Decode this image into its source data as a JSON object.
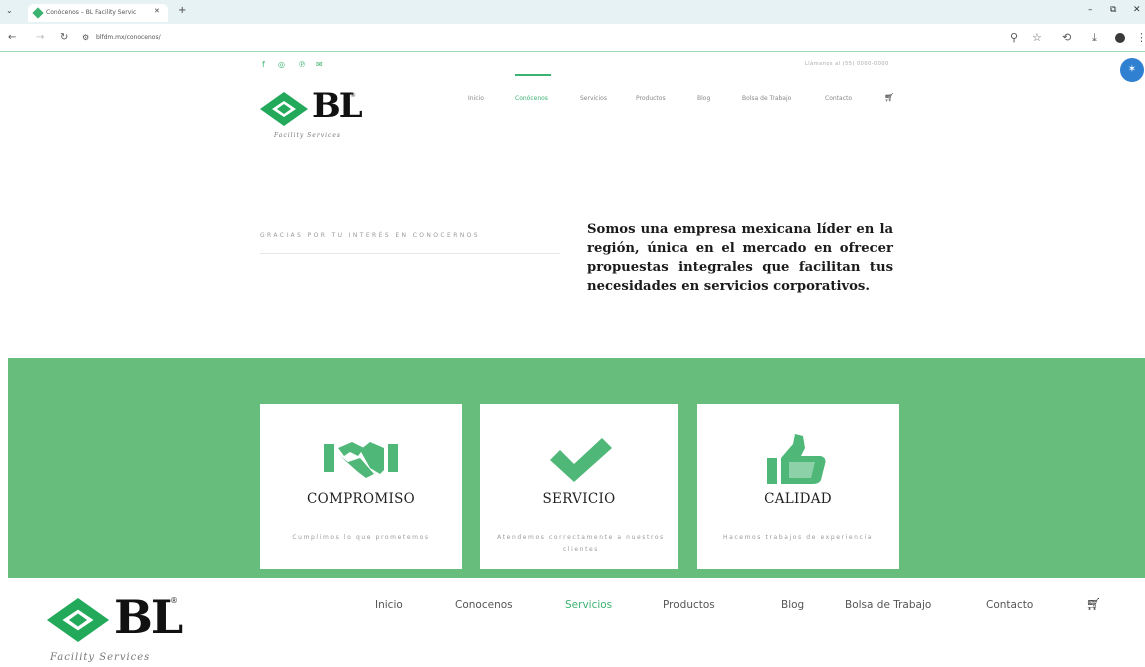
{
  "browser": {
    "tab_title": "Conócenos – BL Facility Servic",
    "tab_close": "✕",
    "new_tab": "+",
    "url": "blfdm.mx/conocenos/"
  },
  "site": {
    "logo_text": "BL",
    "logo_reg": "®",
    "logo_tagline": "Facility Services",
    "contact_line": "Llámanos al (55) 0000-0000",
    "nav": [
      "Inicio",
      "Conócenos",
      "Servicios",
      "Productos",
      "Blog",
      "Bolsa de Trabajo",
      "Contacto"
    ],
    "nav_active_top": "Conócenos",
    "bottom_nav": [
      "Inicio",
      "Conocenos",
      "Servicios",
      "Productos",
      "Blog",
      "Bolsa de Trabajo",
      "Contacto"
    ],
    "nav_active_bottom": "Servicios"
  },
  "intro": {
    "gracias": "GRACIAS POR TU INTERÉS EN CONOCERNOS",
    "text": "Somos una empresa mexicana líder en la región, única en el mercado en ofrecer propuestas integrales que facilitan tus necesidades en servicios corporativos."
  },
  "cards": [
    {
      "icon": "handshake-icon",
      "title": "COMPROMISO",
      "desc": "Cumplimos lo que prometemos"
    },
    {
      "icon": "checkmark-icon",
      "title": "SERVICIO",
      "desc": "Atendemos correctamente a nuestros clientes"
    },
    {
      "icon": "thumbs-up-icon",
      "title": "CALIDAD",
      "desc": "Hacemos trabajos de experiencia"
    }
  ],
  "colors": {
    "brand_green": "#3cb371",
    "band_green": "#66bd7c",
    "text_dark": "#1b1b1b"
  }
}
